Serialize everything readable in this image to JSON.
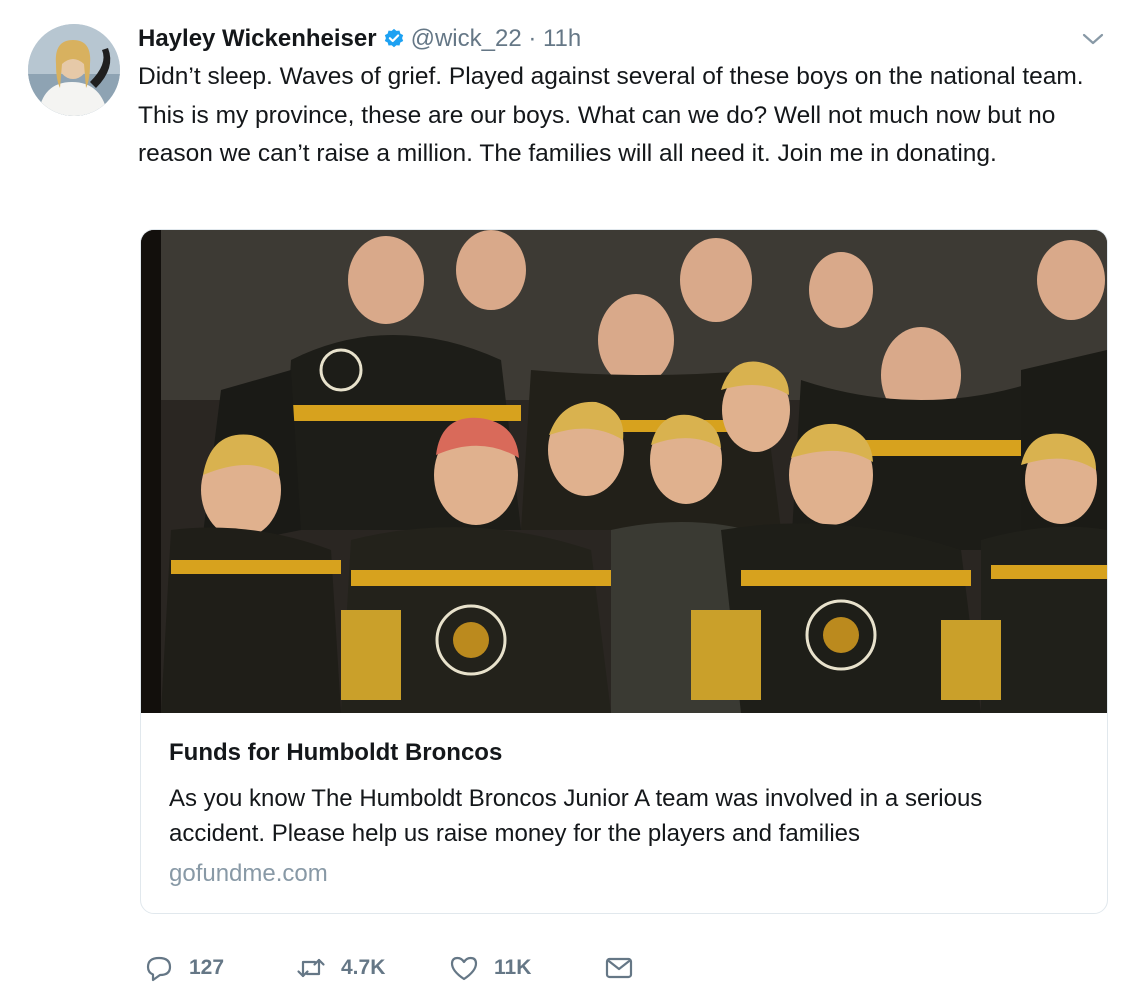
{
  "tweet": {
    "author_name": "Hayley Wickenheiser",
    "handle_time": "@wick_22 · 11h",
    "text": "Didn’t sleep. Waves of grief. Played against several of these boys on the national team. This is my province, these are our boys. What can we do? Well not much now but no reason we can’t raise a million. The families will all need it. Join me in donating."
  },
  "card": {
    "title": "Funds for Humboldt Broncos",
    "description": "As you know The Humboldt Broncos Junior A team was involved in a serious accident. Please help us raise money for the players and families",
    "domain": "gofundme.com"
  },
  "actions": {
    "replies": "127",
    "retweets": "4.7K",
    "likes": "11K"
  },
  "colors": {
    "verified": "#1da1f2",
    "secondary_text": "#657786",
    "domain_text": "#8899a6",
    "border": "#e1e8ed"
  },
  "icons": [
    "verified-badge-icon",
    "chevron-down-icon",
    "reply-icon",
    "retweet-icon",
    "like-icon",
    "message-icon"
  ]
}
